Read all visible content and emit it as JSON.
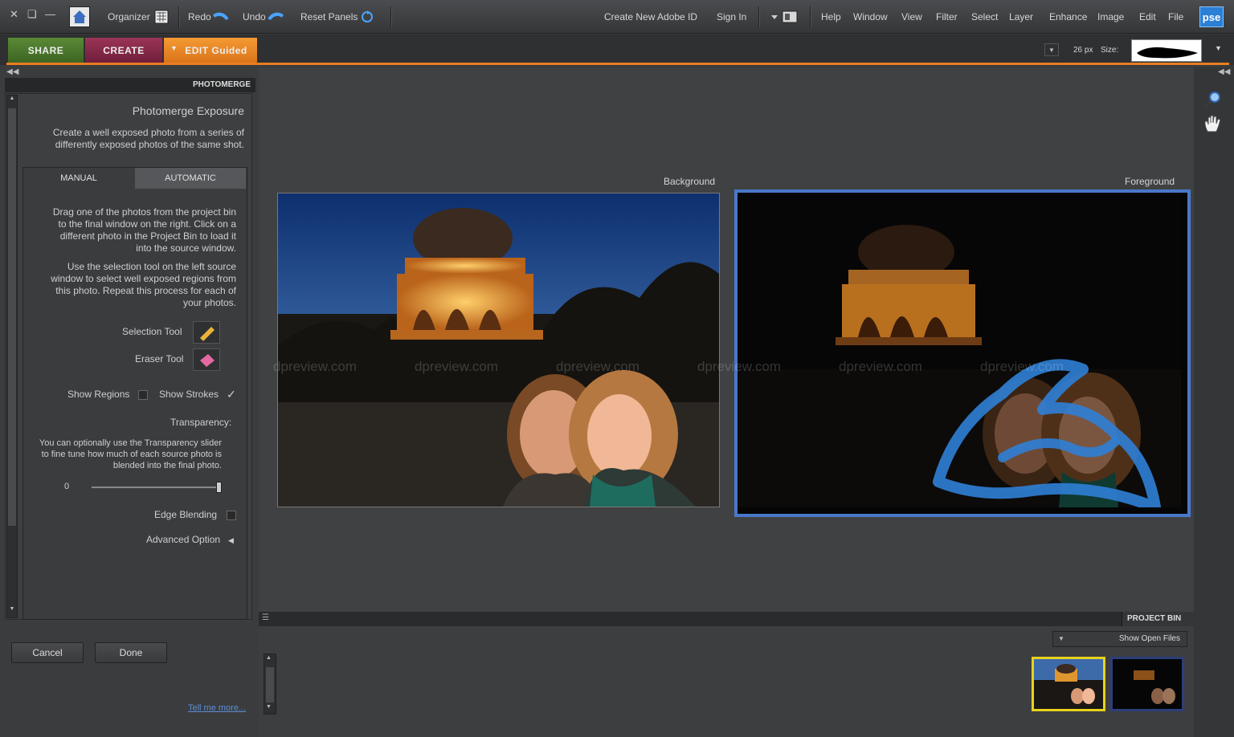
{
  "menubar": {
    "logo": "pse",
    "menu": [
      "File",
      "Edit",
      "Image",
      "Enhance",
      "Layer",
      "Select",
      "Filter",
      "View",
      "Window",
      "Help"
    ],
    "sign_in": "Sign In",
    "create_id": "Create New Adobe ID",
    "reset_panels": "Reset Panels",
    "undo": "Undo",
    "redo": "Redo",
    "organizer": "Organizer",
    "icons": [
      "home-icon",
      "organizer-grid-icon",
      "layout-icon",
      "minimize-icon",
      "restore-icon",
      "close-icon"
    ]
  },
  "options_bar": {
    "size_label": "Size:",
    "size_value": "26 px"
  },
  "mode_tabs": {
    "edit": "EDIT Guided",
    "create": "CREATE",
    "share": "SHARE",
    "colors": {
      "edit": "#e98a22",
      "create": "#8c2a4a",
      "share": "#4c7a2a"
    }
  },
  "panel": {
    "header": "PHOTOMERGE",
    "title": "Photomerge Exposure",
    "intro": [
      "Create a well exposed photo from a series of",
      "differently exposed photos of the same shot."
    ],
    "tab_automatic": "AUTOMATIC",
    "tab_manual": "MANUAL",
    "step1": [
      "Drag one of the photos from the project bin",
      "to the final window on the right. Click on a",
      "different photo in the Project Bin to load it",
      "into the source window."
    ],
    "step2": [
      "Use the selection tool on the left source",
      "window to select well exposed regions from",
      "this photo. Repeat this process for each of",
      "your photos."
    ],
    "selection_tool": "Selection Tool",
    "eraser_tool": "Eraser Tool",
    "show_strokes": "Show Strokes",
    "show_regions": "Show Regions",
    "transparency_label": "Transparency:",
    "transparency_help": [
      "You can optionally use the Transparency slider",
      "to fine tune how much of each source photo is",
      "blended into the final photo."
    ],
    "transparency_value": "0",
    "edge_blending": "Edge Blending",
    "advanced_option": "Advanced Option",
    "done": "Done",
    "cancel": "Cancel",
    "tell_me_more": "Tell me more..."
  },
  "main": {
    "background_label": "Background",
    "foreground_label": "Foreground",
    "watermark": "dpreview.com"
  },
  "project_bin": {
    "title": "PROJECT BIN",
    "show_dropdown": "Show Open Files"
  }
}
